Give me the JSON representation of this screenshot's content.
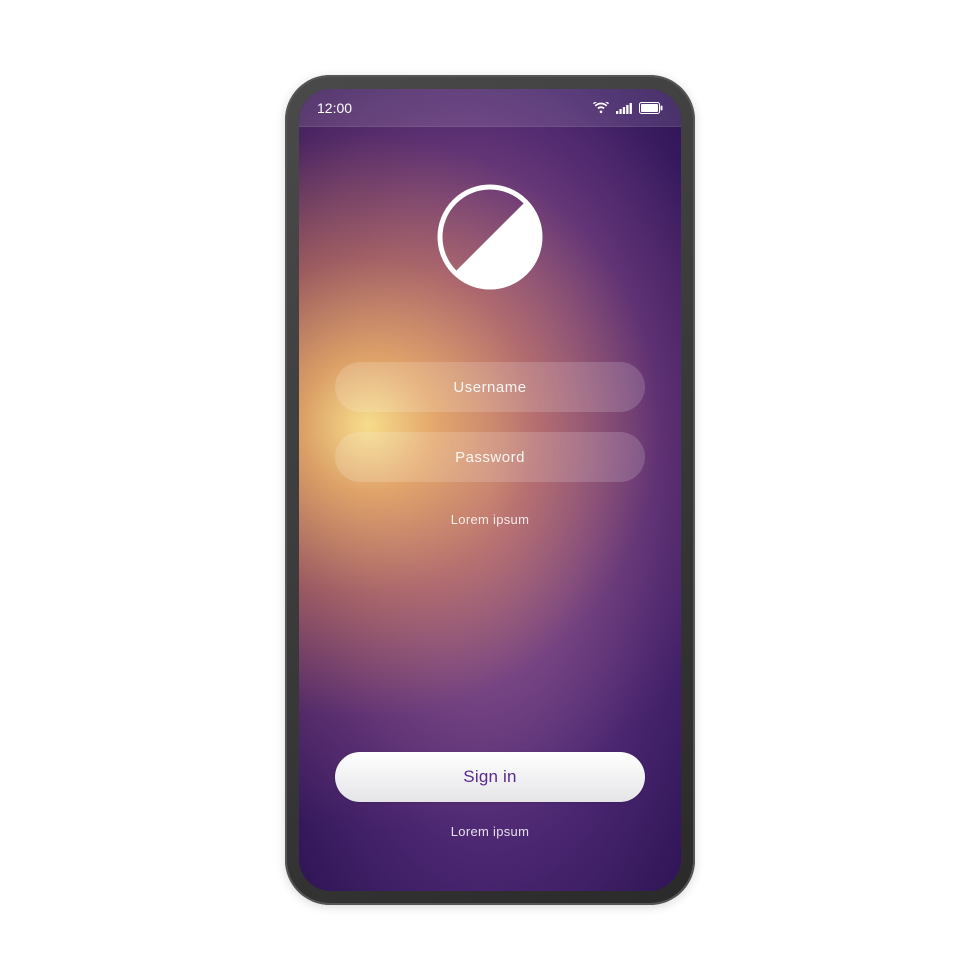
{
  "statusBar": {
    "time": "12:00",
    "icons": {
      "wifi": "wifi-icon",
      "signal": "signal-icon",
      "battery": "battery-icon"
    }
  },
  "login": {
    "logo": "half-circle-logo",
    "username_placeholder": "Username",
    "username_value": "",
    "password_placeholder": "Password",
    "password_value": "",
    "helper_text_1": "Lorem ipsum",
    "signin_label": "Sign in",
    "helper_text_2": "Lorem ipsum"
  },
  "colors": {
    "accent": "#5a2a8a",
    "bg_purple": "#3a1b5f",
    "glow": "#ffb863"
  }
}
